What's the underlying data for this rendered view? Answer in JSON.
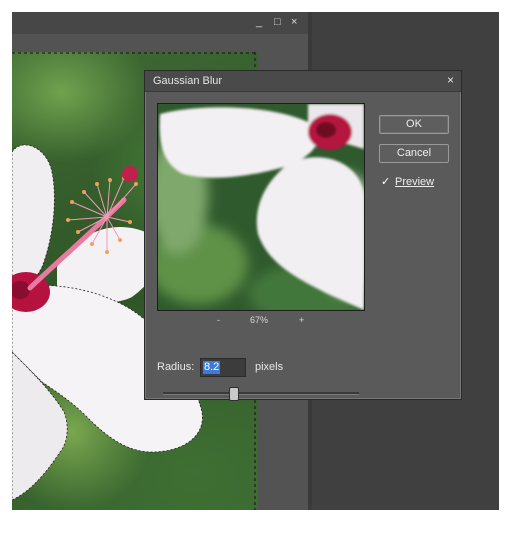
{
  "window": {
    "minimize_glyph": "_",
    "maximize_glyph": "□",
    "close_glyph": "×"
  },
  "dialog": {
    "title": "Gaussian Blur",
    "close_glyph": "×",
    "ok_label": "OK",
    "cancel_label": "Cancel",
    "preview_checkbox": {
      "label": "Preview",
      "checked": true,
      "check_glyph": "✓"
    },
    "zoom": {
      "minus": "-",
      "value": "67%",
      "plus": "+"
    },
    "radius": {
      "label": "Radius:",
      "value": "8.2",
      "unit": "pixels"
    },
    "slider": {
      "fraction": 0.36
    }
  },
  "colors": {
    "flower_petal": "#f3f0f3",
    "flower_center": "#b5123f",
    "stamen": "#e86e9a"
  }
}
